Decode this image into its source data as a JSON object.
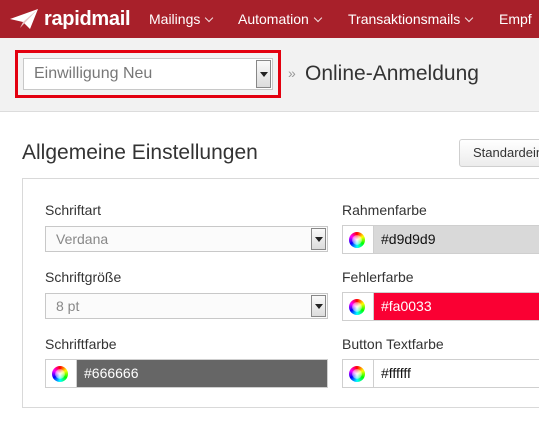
{
  "nav": {
    "logo": "rapidmail",
    "items": [
      "Mailings",
      "Automation",
      "Transaktionsmails",
      "Empf"
    ]
  },
  "header": {
    "form_select": "Einwilligung Neu",
    "separator": "»",
    "title": "Online-Anmeldung"
  },
  "main": {
    "section_title": "Allgemeine Einstellungen",
    "defaults_button": "Standardein"
  },
  "settings": {
    "font_family": {
      "label": "Schriftart",
      "value": "Verdana"
    },
    "font_size": {
      "label": "Schriftgröße",
      "value": "8 pt"
    },
    "font_color": {
      "label": "Schriftfarbe",
      "value": "#666666"
    },
    "border_color": {
      "label": "Rahmenfarbe",
      "value": "#d9d9d9"
    },
    "error_color": {
      "label": "Fehlerfarbe",
      "value": "#fa0033"
    },
    "button_text_color": {
      "label": "Button Textfarbe",
      "value": "#ffffff"
    }
  },
  "colors": {
    "brand": "#a8202a",
    "highlight": "#e3000f"
  }
}
